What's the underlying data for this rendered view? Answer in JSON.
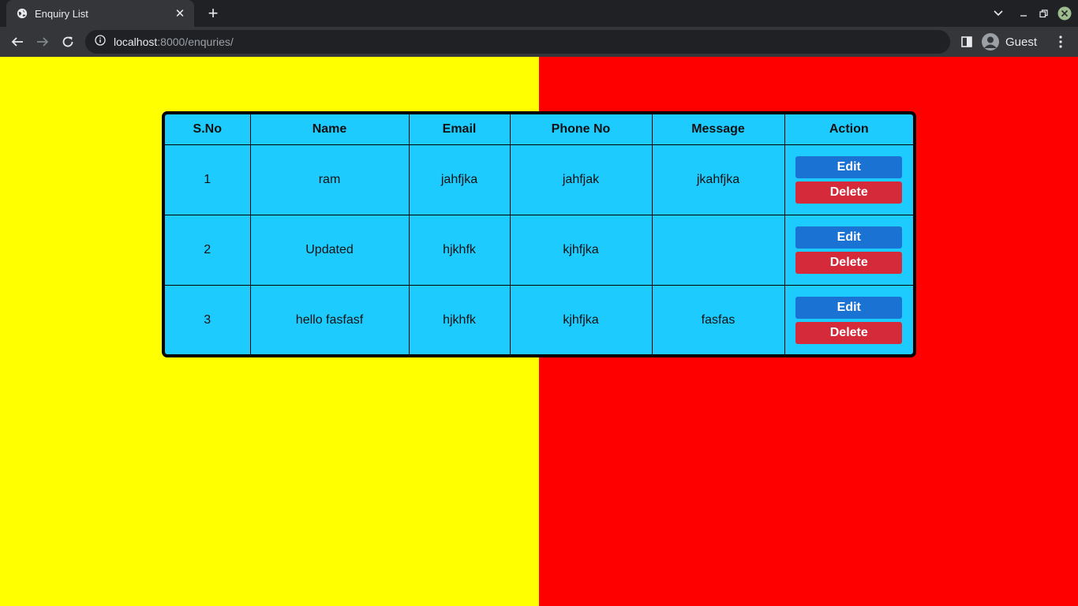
{
  "browser": {
    "tab_title": "Enquiry List",
    "url_host": "localhost",
    "url_path": ":8000/enquries/",
    "profile_label": "Guest",
    "new_tab_glyph": "+",
    "close_tab_glyph": "✕"
  },
  "colors": {
    "left_bg": "#ffff00",
    "right_bg": "#ff0000",
    "table_bg": "#1ecbff",
    "edit_btn": "#1a73d2",
    "delete_btn": "#d42a3a"
  },
  "table": {
    "headers": [
      "S.No",
      "Name",
      "Email",
      "Phone No",
      "Message",
      "Action"
    ],
    "rows": [
      {
        "sno": "1",
        "name": "ram",
        "email": "jahfjka",
        "phone": "jahfjak",
        "message": "jkahfjka"
      },
      {
        "sno": "2",
        "name": "Updated",
        "email": "hjkhfk",
        "phone": "kjhfjka",
        "message": ""
      },
      {
        "sno": "3",
        "name": "hello fasfasf",
        "email": "hjkhfk",
        "phone": "kjhfjka",
        "message": "fasfas"
      }
    ],
    "edit_label": "Edit",
    "delete_label": "Delete"
  }
}
